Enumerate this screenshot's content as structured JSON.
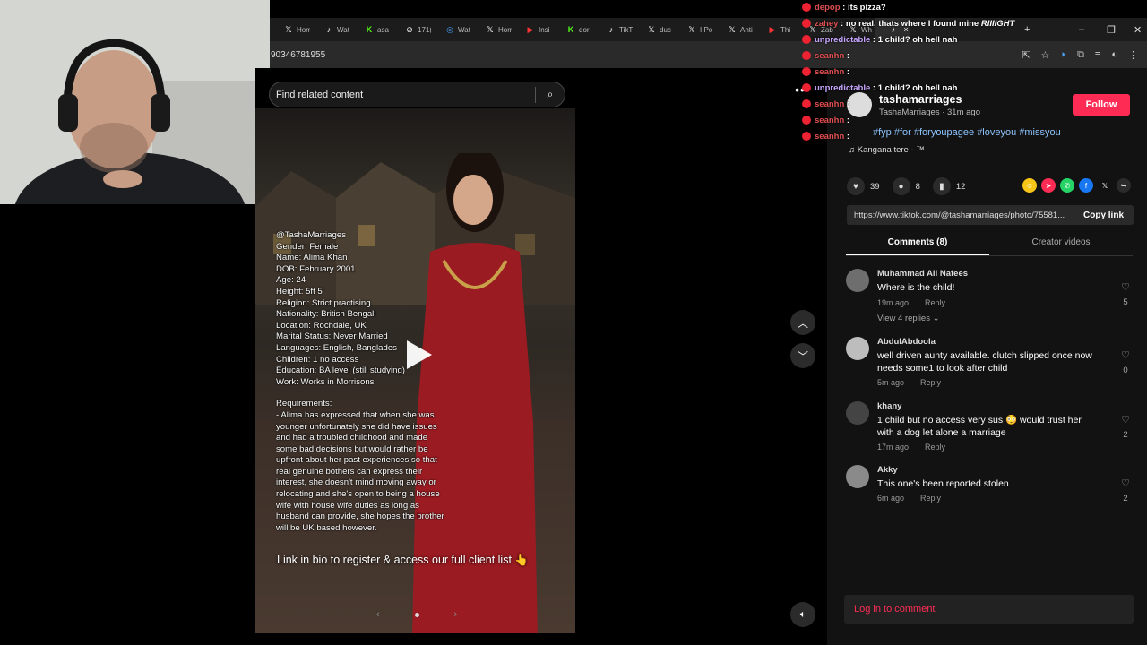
{
  "browser": {
    "tabs": [
      {
        "icon": "x-icon",
        "label": "Hom"
      },
      {
        "icon": "tiktok-icon",
        "label": "Wat"
      },
      {
        "icon": "kick-icon",
        "label": "asa"
      },
      {
        "icon": "link-icon",
        "label": "171("
      },
      {
        "icon": "globe-icon",
        "label": "Wat"
      },
      {
        "icon": "x-icon",
        "label": "Hom"
      },
      {
        "icon": "youtube-icon",
        "label": "Insi"
      },
      {
        "icon": "kick-icon",
        "label": "qor"
      },
      {
        "icon": "tiktok-icon",
        "label": "TikT"
      },
      {
        "icon": "x-icon",
        "label": "duc"
      },
      {
        "icon": "x-icon",
        "label": "I Po"
      },
      {
        "icon": "x-icon",
        "label": "Anti"
      },
      {
        "icon": "youtube-icon",
        "label": "Thi"
      },
      {
        "icon": "x-icon",
        "label": "Zab"
      },
      {
        "icon": "x-icon",
        "label": "Wh"
      }
    ],
    "url": "90346781955"
  },
  "chat": [
    {
      "user": "depop",
      "text": ": its pizza?",
      "color": "u1"
    },
    {
      "user": "zahey",
      "text": ": no real, thats where I found mine",
      "color": "u1",
      "suffix": "RIIIIGHT"
    },
    {
      "user": "unpredictable",
      "text": ": 1 child? oh hell nah",
      "color": "u2"
    },
    {
      "user": "seanhn",
      "text": ":",
      "color": "u1"
    },
    {
      "user": "seanhn",
      "text": ":",
      "color": "u1"
    },
    {
      "user": "unpredictable",
      "text": ": 1 child? oh hell nah",
      "color": "u2"
    },
    {
      "user": "seanhn",
      "text": ":",
      "color": "u1"
    },
    {
      "user": "seanhn",
      "text": ":",
      "color": "u1"
    },
    {
      "user": "seanhn",
      "text": ":",
      "color": "u1"
    }
  ],
  "search": {
    "placeholder": "Find related content"
  },
  "post": {
    "overlay_lines": [
      "@TashaMarriages",
      "Gender: Female",
      "Name: Alima Khan",
      "DOB: February 2001",
      "Age: 24",
      "Height: 5ft 5'",
      "Religion: Strict practising",
      "Nationality: British Bengali",
      "Location: Rochdale, UK",
      "Marital Status: Never Married",
      "Languages: English, Banglades",
      "Children: 1 no access",
      "Education: BA level (still studying)",
      "Work: Works in Morrisons"
    ],
    "requirements_lines": [
      "Requirements:",
      "- Alima has expressed that when she was",
      "younger unfortunately she did have issues",
      "and had a troubled childhood and made",
      "some bad decisions but would rather be",
      "upfront about her past experiences so that",
      "real genuine bothers can express their",
      "interest, she doesn't mind moving away or",
      "relocating and she's open to being a house",
      "wife with house wife duties as long as",
      "husband can provide, she hopes the brother",
      "will be UK based however."
    ],
    "link_line": "Link in bio to register & access our full client list 👆"
  },
  "author": {
    "name": "tashamarriages",
    "sub": "TashaMarriages · 31m ago",
    "follow_label": "Follow",
    "tags": "#fyp #for #foryoupagee #loveyou #missyou",
    "music": "Kangana tere - ™"
  },
  "stats": {
    "likes": "39",
    "comments": "8",
    "saves": "12"
  },
  "share_colors": [
    "#f5c518",
    "#fe2c55",
    "#25d366",
    "#1877f2",
    "#111111",
    "#2b2b2b"
  ],
  "link": {
    "url": "https://www.tiktok.com/@tashamarriages/photo/75581...",
    "copy_label": "Copy link"
  },
  "tabs": {
    "comments": "Comments (8)",
    "creator": "Creator videos"
  },
  "comments": [
    {
      "name": "Muhammad Ali Nafees",
      "text": "Where is the child!",
      "time": "19m ago",
      "reply": "Reply",
      "likes": "5"
    },
    {
      "name": "AbdulAbdoola",
      "text": "well driven aunty available. clutch slipped once now needs some1 to look after child",
      "time": "5m ago",
      "reply": "Reply",
      "likes": "0"
    },
    {
      "name": "khany",
      "text": "1 child but no access very sus 😳 would trust her with a dog let alone a marriage",
      "time": "17m ago",
      "reply": "Reply",
      "likes": "2"
    },
    {
      "name": "Akky",
      "text": "This one's been reported stolen",
      "time": "6m ago",
      "reply": "Reply",
      "likes": "2"
    }
  ],
  "view_replies": "View 4 replies",
  "login": {
    "label": "Log in to comment"
  }
}
